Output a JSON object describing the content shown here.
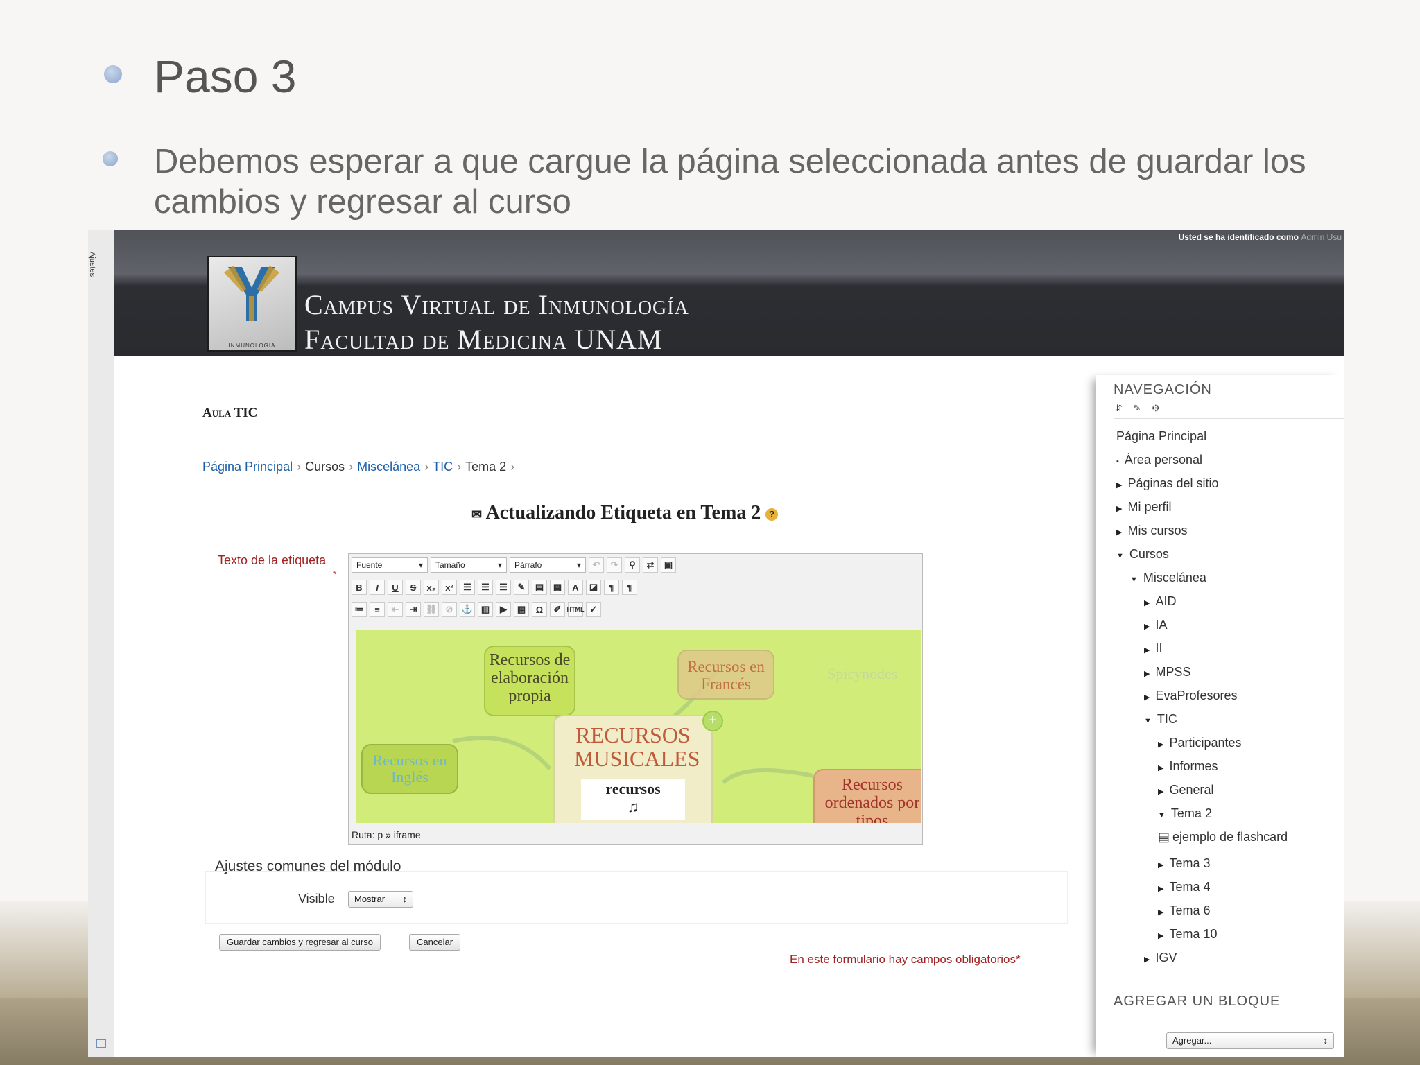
{
  "slide": {
    "title": "Paso 3",
    "body": "Debemos esperar a que cargue la página seleccionada antes de guardar los cambios y regresar al curso"
  },
  "screenshot": {
    "sidebar_label": "Ajustes",
    "login_text": "Usted se ha identificado como",
    "login_user": "Admin Usu",
    "logo_caption": "INMUNOLOGÍA",
    "site_title_line1": "Campus Virtual de Inmunología",
    "site_title_line2": "Facultad de Medicina UNAM",
    "course_name": "Aula TIC",
    "breadcrumb": [
      "Página Principal",
      "Cursos",
      "Miscelánea",
      "TIC",
      "Tema 2"
    ],
    "heading": "Actualizando Etiqueta en Tema 2",
    "field_label": "Texto de la etiqueta",
    "required_star": "*",
    "editor": {
      "font_select": "Fuente",
      "size_select": "Tamaño",
      "format_select": "Párrafo",
      "status_path": "Ruta: p » iframe",
      "mindmap": {
        "center": "RECURSOS MUSICALES",
        "center_image_text": "recursos",
        "node_propia": "Recursos de elaboración propia",
        "node_frances": "Recursos en Francés",
        "node_ingles": "Recursos en Inglés",
        "node_ordenados": "Recursos ordenados por tipos",
        "watermark": "Spicynodes"
      }
    },
    "section_title": "Ajustes comunes del módulo",
    "visible_label": "Visible",
    "visible_value": "Mostrar",
    "save_button": "Guardar cambios y regresar al curso",
    "cancel_button": "Cancelar",
    "required_note": "En este formulario hay campos obligatorios*",
    "nav": {
      "title": "NAVEGACIÓN",
      "items": [
        {
          "label": "Página Principal"
        },
        {
          "label": "Área personal"
        },
        {
          "label": "Páginas del sitio"
        },
        {
          "label": "Mi perfil"
        },
        {
          "label": "Mis cursos"
        },
        {
          "label": "Cursos"
        },
        {
          "label": "Miscelánea"
        },
        {
          "label": "AID"
        },
        {
          "label": "IA"
        },
        {
          "label": "II"
        },
        {
          "label": "MPSS"
        },
        {
          "label": "EvaProfesores"
        },
        {
          "label": "TIC"
        },
        {
          "label": "Participantes"
        },
        {
          "label": "Informes"
        },
        {
          "label": "General"
        },
        {
          "label": "Tema 2"
        },
        {
          "label": "ejemplo de flashcard"
        },
        {
          "label": "Tema 3"
        },
        {
          "label": "Tema 4"
        },
        {
          "label": "Tema 6"
        },
        {
          "label": "Tema 10"
        },
        {
          "label": "IGV"
        }
      ]
    },
    "add_block_title": "AGREGAR UN BLOQUE",
    "add_block_select": "Agregar..."
  },
  "colors": {
    "link": "#1a5fa8",
    "required": "#a02323",
    "editor_bg": "#d2ec7a"
  }
}
